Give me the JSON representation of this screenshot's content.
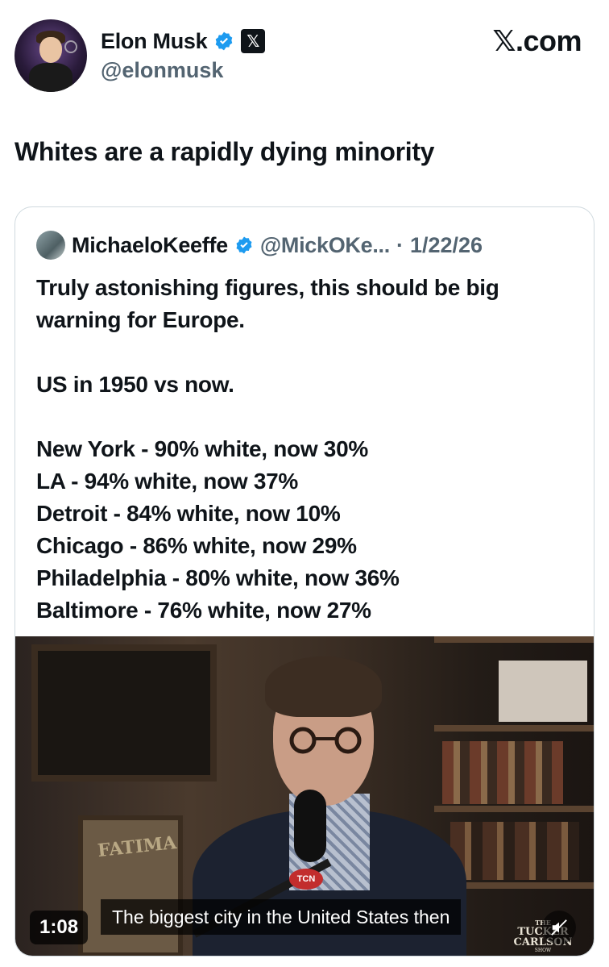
{
  "author": {
    "display_name": "Elon Musk",
    "handle": "@elonmusk",
    "x_badge": "𝕏"
  },
  "site_watermark": "𝕏.com",
  "tweet": {
    "text": "Whites are a rapidly dying minority"
  },
  "quoted_tweet": {
    "display_name": "MichaeloKeeffe",
    "handle": "@MickOKe...",
    "separator": "·",
    "date": "1/22/26",
    "lines": [
      "Truly astonishing figures, this should be big warning for Europe.",
      "",
      "US in 1950 vs now.",
      "",
      "New York - 90% white, now 30%",
      "LA - 94% white, now 37%",
      "Detroit - 84% white, now 10%",
      "Chicago - 86% white, now 29%",
      "Philadelphia - 80% white, now 36%",
      "Baltimore - 76% white, now 27%"
    ]
  },
  "video": {
    "duration": "1:08",
    "caption": "The biggest city in the United States then",
    "frame_text": "FATIMA",
    "mic_label": "TCN",
    "logo": {
      "line1": "THE",
      "line2": "TUCKER CARLSON",
      "line3": "SHOW"
    }
  },
  "colors": {
    "text_primary": "#0f1419",
    "text_secondary": "#536471",
    "verified_blue": "#1d9bf0",
    "border": "#cfd9de"
  }
}
